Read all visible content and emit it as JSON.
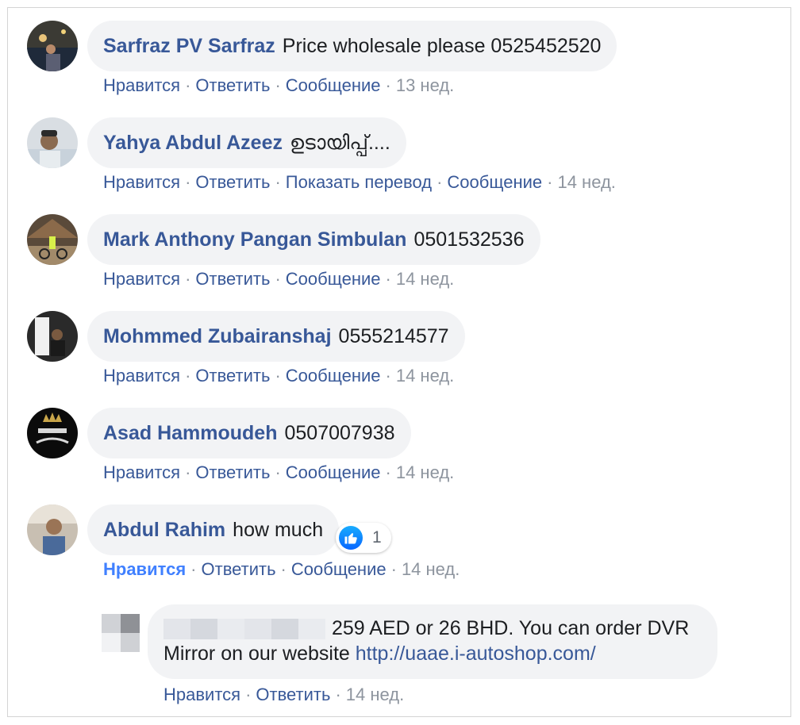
{
  "actions": {
    "like": "Нравится",
    "reply": "Ответить",
    "message": "Сообщение",
    "translate": "Показать перевод",
    "separator": "·"
  },
  "comments": [
    {
      "author": "Sarfraz PV Sarfraz",
      "text": "Price wholesale please 0525452520",
      "time": "13 нед."
    },
    {
      "author": "Yahya Abdul Azeez",
      "text": "ഉടായിപ്പ്....",
      "time": "14 нед."
    },
    {
      "author": "Mark Anthony Pangan Simbulan",
      "text": "0501532536",
      "time": "14 нед."
    },
    {
      "author": "Mohmmed Zubairanshaj",
      "text": "0555214577",
      "time": "14 нед."
    },
    {
      "author": "Asad Hammoudeh",
      "text": "0507007938",
      "time": "14 нед."
    },
    {
      "author": "Abdul Rahim",
      "text": "how much",
      "time": "14 нед.",
      "reaction_count": "1"
    }
  ],
  "reply": {
    "text": "259 AED or 26 BHD. You can order DVR Mirror on our website",
    "link": "http://uaae.i-autoshop.com/",
    "time": "14 нед."
  },
  "colors": {
    "link": "#385898",
    "liked": "#4080ff",
    "bubble": "#f2f3f5",
    "meta": "#8d949e"
  },
  "icons": {
    "reaction": "thumbs-up-icon"
  }
}
